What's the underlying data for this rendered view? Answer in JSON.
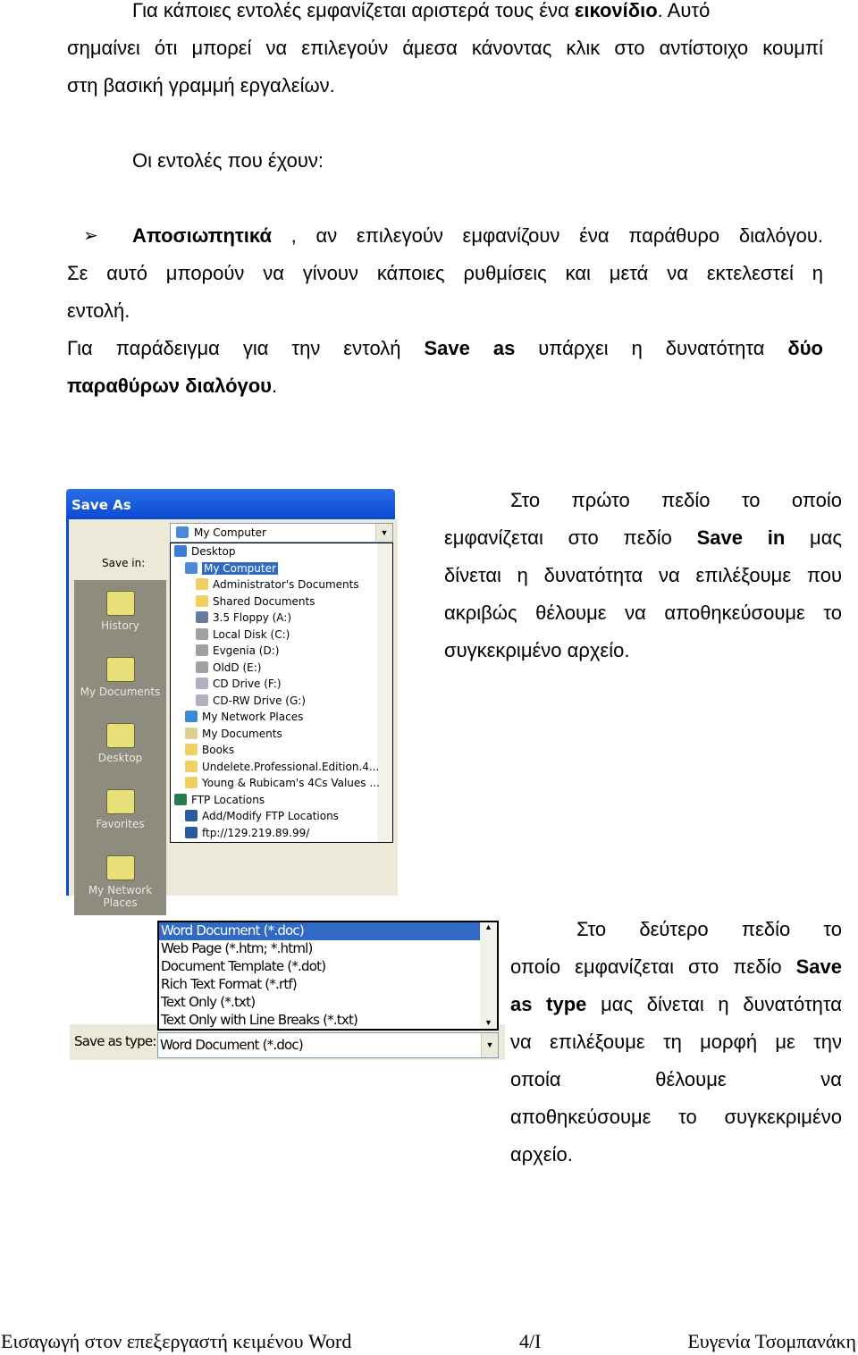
{
  "intro": {
    "l1a": "Για κάποιες εντολές εμφανίζεται αριστερά τους ένα ",
    "l1b": "εικονίδιο",
    "l1c": ". Αυτό",
    "l2": "σημαίνει ότι μπορεί να επιλεγούν άμεσα κάνοντας κλικ στο αντίστοιχο κουμπί",
    "l3": "στη βασική γραμμή εργαλείων."
  },
  "p2": "Οι εντολές που έχουν:",
  "bullet": {
    "icon": "arrowhead-bullet-icon",
    "b": "Αποσιωπητικά",
    "rest": " , αν επιλεγούν εμφανίζουν ένα παράθυρο διαλόγου.",
    "l2": "Σε αυτό μπορούν να γίνουν κάποιες ρυθμίσεις και μετά να εκτελεστεί η",
    "l3": "εντολή.",
    "l4a": "Για παράδειγμα για την εντολή ",
    "l4b": "Save as",
    "l4c": " υπάρχει η δυνατότητα ",
    "l4d": "δύο",
    "l5a": "παραθύρων διαλόγου",
    "l5b": "."
  },
  "col1": {
    "l1": "Στο πρώτο πεδίο το οποίο",
    "l2a": "εμφανίζεται στο πεδίο ",
    "l2b": "Save in",
    "l2c": " μας",
    "l3": "δίνεται η δυνατότητα να επιλέξουμε που",
    "l4": "ακριβώς θέλουμε να αποθηκεύσουμε το",
    "l5": "συγκεκριμένο αρχείο."
  },
  "col2": {
    "l1": "Στο δεύτερο πεδίο το",
    "l2a": "οποίο εμφανίζεται στο πεδίο ",
    "l2b": "Save",
    "l3a": "as type",
    "l3b": " μας δίνεται η δυνατότητα",
    "l4": "να επιλέξουμε τη μορφή με την",
    "l5": "οποία θέλουμε να",
    "l6": "αποθηκεύσουμε το συγκεκριμένο",
    "l7": "αρχείο."
  },
  "dialog": {
    "title": "Save As",
    "save_in_label": "Save in:",
    "save_in_value": "My Computer",
    "places": [
      "History",
      "My Documents",
      "Desktop",
      "Favorites",
      "My Network Places"
    ],
    "items": [
      {
        "label": "Desktop",
        "indent": 0,
        "color": "#3a7bd5"
      },
      {
        "label": "My Computer",
        "indent": 1,
        "color": "#4a8ad8",
        "selected": true
      },
      {
        "label": "Administrator's Documents",
        "indent": 2,
        "color": "#f0d060"
      },
      {
        "label": "Shared Documents",
        "indent": 2,
        "color": "#f0d060"
      },
      {
        "label": "3.5 Floppy (A:)",
        "indent": 2,
        "color": "#6a7a9a"
      },
      {
        "label": "Local Disk (C:)",
        "indent": 2,
        "color": "#a0a0a0"
      },
      {
        "label": "Evgenia (D:)",
        "indent": 2,
        "color": "#a0a0a0"
      },
      {
        "label": "OldD (E:)",
        "indent": 2,
        "color": "#a0a0a0"
      },
      {
        "label": "CD Drive (F:)",
        "indent": 2,
        "color": "#b0b0c0"
      },
      {
        "label": "CD-RW Drive (G:)",
        "indent": 2,
        "color": "#b0b0c0"
      },
      {
        "label": "My Network Places",
        "indent": 1,
        "color": "#3a8ad8"
      },
      {
        "label": "My Documents",
        "indent": 1,
        "color": "#e0d090"
      },
      {
        "label": "Books",
        "indent": 1,
        "color": "#f0d060"
      },
      {
        "label": "Undelete.Professional.Edition.4...",
        "indent": 1,
        "color": "#f0d060"
      },
      {
        "label": "Young & Rubicam's 4Cs Values ...",
        "indent": 1,
        "color": "#f0d060"
      },
      {
        "label": "FTP Locations",
        "indent": 0,
        "color": "#2a7a50"
      },
      {
        "label": "Add/Modify FTP Locations",
        "indent": 1,
        "color": "#2a5aa0"
      },
      {
        "label": "ftp://129.219.89.99/",
        "indent": 1,
        "color": "#2a5aa0"
      }
    ]
  },
  "type_dialog": {
    "label": "Save as type:",
    "value": "Word Document (*.doc)",
    "options": [
      "Word Document (*.doc)",
      "Web Page (*.htm; *.html)",
      "Document Template (*.dot)",
      "Rich Text Format (*.rtf)",
      "Text Only (*.txt)",
      "Text Only with Line Breaks (*.txt)"
    ]
  },
  "footer": {
    "left": "Εισαγωγή στον επεξεργαστή κειμένου Word",
    "center": "4/I",
    "right": "Ευγενία Τσομπανάκη"
  }
}
